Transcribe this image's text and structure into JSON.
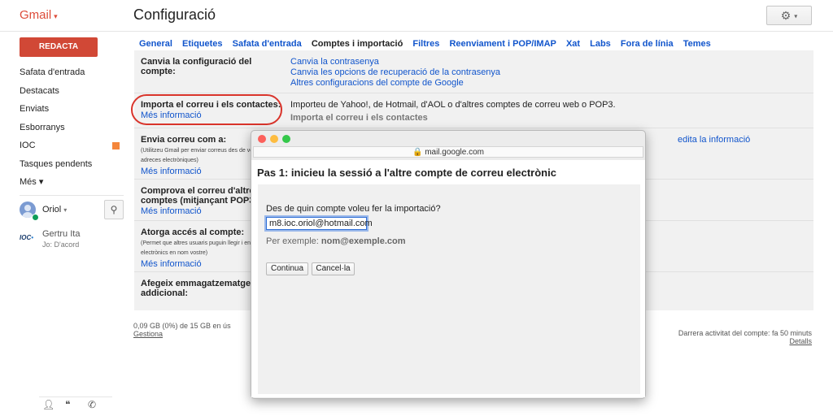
{
  "header": {
    "brand": "Gmail",
    "brand_caret": "▾",
    "page_title": "Configuració",
    "gear_glyph": "⚙",
    "gear_caret": "▾"
  },
  "sidebar": {
    "compose_label": "REDACTA",
    "items": [
      {
        "label": "Safata d'entrada"
      },
      {
        "label": "Destacats"
      },
      {
        "label": "Enviats"
      },
      {
        "label": "Esborranys"
      },
      {
        "label": "IOC",
        "tag_color": "#f4863b"
      },
      {
        "label": "Tasques pendents"
      },
      {
        "label": "Més ▾"
      }
    ],
    "user": {
      "name": "Oriol",
      "caret": "▾"
    },
    "search_icon": "search-icon",
    "contact": {
      "logo": "IOC",
      "name": "Gertru Ita",
      "status": "Jo: D'acord"
    },
    "bottom_icons": [
      "person-icon",
      "hangouts-icon",
      "phone-icon"
    ]
  },
  "tabs": [
    {
      "label": "General"
    },
    {
      "label": "Etiquetes"
    },
    {
      "label": "Safata d'entrada"
    },
    {
      "label": "Comptes i importació",
      "active": true
    },
    {
      "label": "Filtres"
    },
    {
      "label": "Reenviament i POP/IMAP"
    },
    {
      "label": "Xat"
    },
    {
      "label": "Labs"
    },
    {
      "label": "Fora de línia"
    },
    {
      "label": "Temes"
    }
  ],
  "settings": {
    "account": {
      "label": "Canvia la configuració del compte:",
      "links": [
        "Canvia la contrasenya",
        "Canvia les opcions de recuperació de la contrasenya",
        "Altres configuracions del compte de Google"
      ]
    },
    "import": {
      "label": "Importa el correu i els contactes:",
      "more": "Més informació",
      "text": "Importeu de Yahoo!, de Hotmail, d'AOL o d'altres comptes de correu web o POP3.",
      "action": "Importa el correu i els contactes"
    },
    "send_as": {
      "label": "Envia correu com a:",
      "sub": "(Utilitzeu Gmail per enviar correus des de vostres altres adreces electròniques)",
      "more": "Més informació",
      "edit": "edita la informació"
    },
    "check_mail": {
      "label": "Comprova el correu d'altres comptes (mitjançant POP3):",
      "more": "Més informació"
    },
    "grant_access": {
      "label": "Atorga accés al compte:",
      "sub": "(Permet que altres usuaris puguin llegir i enviar correus electrònics en nom vostre)",
      "more": "Més informació"
    },
    "storage_add": {
      "label": "Afegeix emmagatzematge addicional:"
    }
  },
  "footer": {
    "storage": "0,09 GB (0%) de 15 GB en ús",
    "manage": "Gestiona",
    "activity": "Darrera activitat del compte: fa 50 minuts",
    "details": "Detalls"
  },
  "popup": {
    "url": "🔒 mail.google.com",
    "title": "Pas 1: inicieu la sessió a l'altre compte de correu electrònic",
    "question": "Des de quin compte voleu fer la importació?",
    "email_value": "m8.ioc.oriol@hotmail.com",
    "example_prefix": "Per exemple: ",
    "example_value": "nom@exemple.com",
    "continue_label": "Continua",
    "cancel_label": "Cancel·la",
    "traffic_colors": [
      "#fc605b",
      "#fdbc40",
      "#34c84a"
    ]
  }
}
